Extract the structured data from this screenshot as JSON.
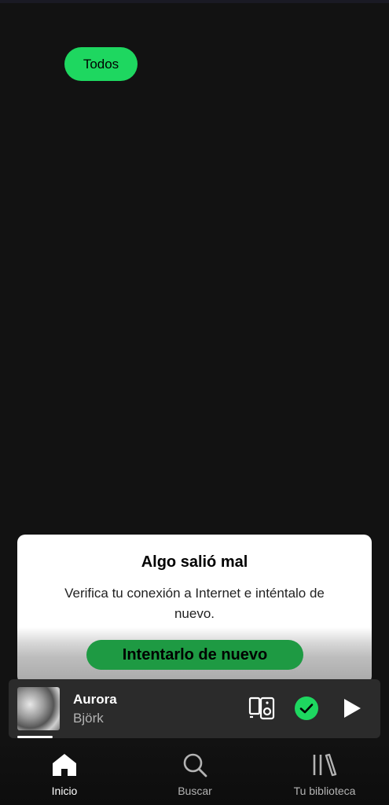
{
  "filters": {
    "all_label": "Todos"
  },
  "error": {
    "title": "Algo salió mal",
    "message": "Verifica tu conexión a Internet e inténtalo de nuevo.",
    "retry_label": "Intentarlo de nuevo"
  },
  "player": {
    "track_title": "Aurora",
    "artist": "Björk",
    "progress_fraction": 0.1,
    "accent_color": "#1ed760"
  },
  "nav": {
    "items": [
      {
        "label": "Inicio",
        "icon": "home-icon",
        "active": true
      },
      {
        "label": "Buscar",
        "icon": "search-icon",
        "active": false
      },
      {
        "label": "Tu biblioteca",
        "icon": "library-icon",
        "active": false
      }
    ]
  }
}
